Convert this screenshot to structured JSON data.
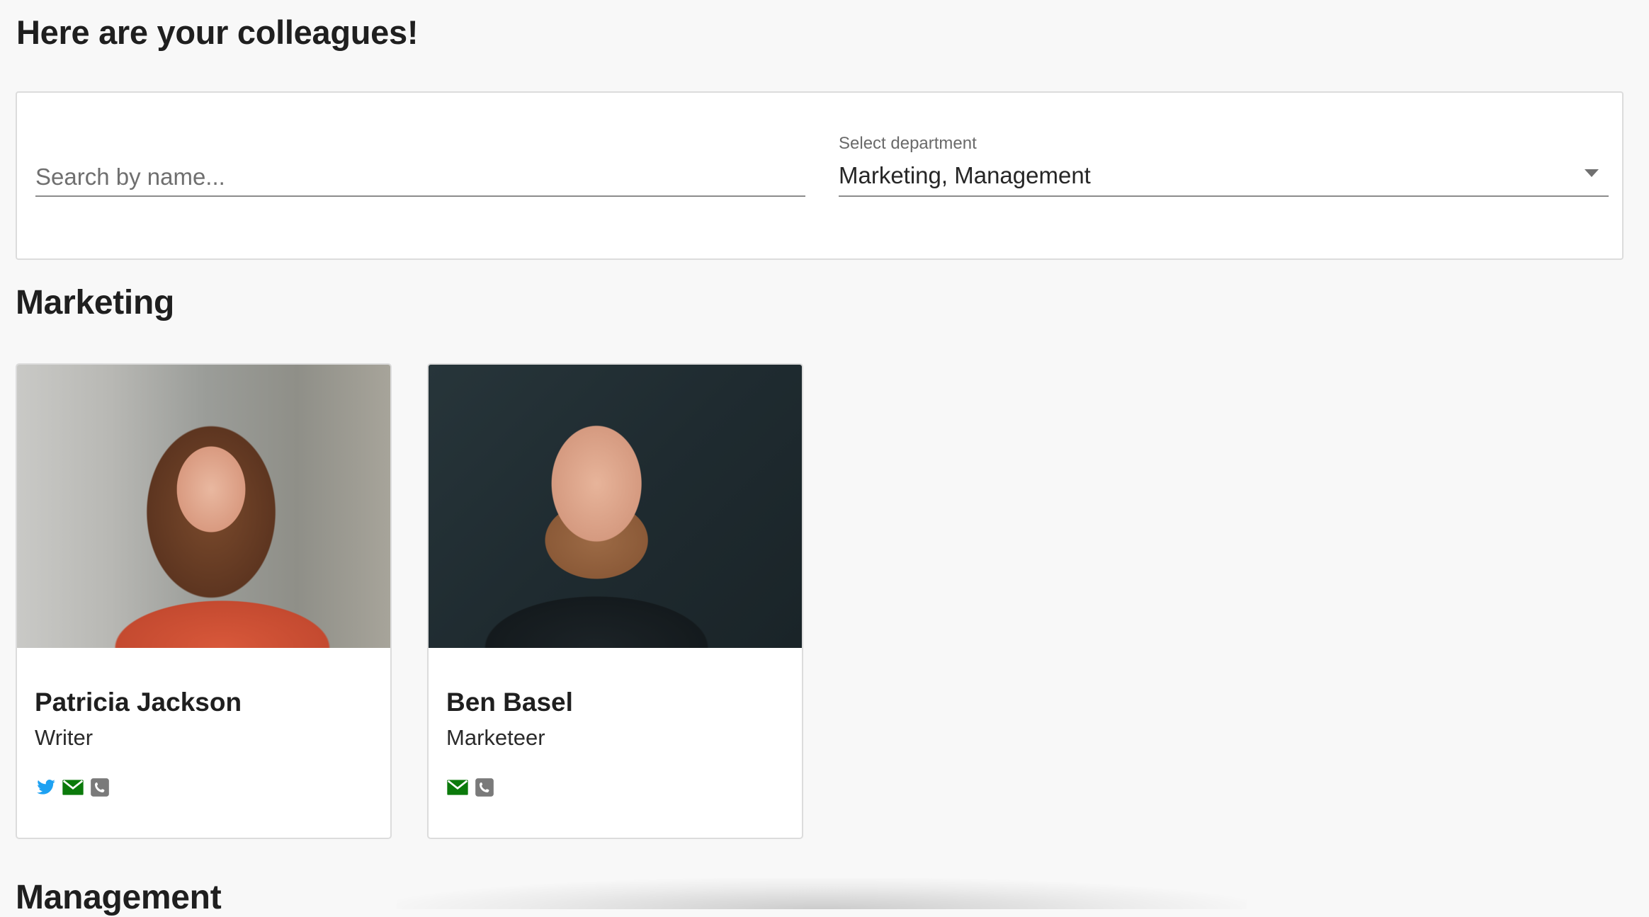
{
  "header": {
    "title": "Here are your colleagues!"
  },
  "filters": {
    "search_placeholder": "Search by name...",
    "search_value": "",
    "department_label": "Select department",
    "department_value": "Marketing, Management"
  },
  "sections": [
    {
      "title": "Marketing",
      "colleagues": [
        {
          "name": "Patricia Jackson",
          "role": "Writer",
          "contacts": [
            "twitter-icon",
            "email-icon",
            "phone-icon"
          ]
        },
        {
          "name": "Ben Basel",
          "role": "Marketeer",
          "contacts": [
            "email-icon",
            "phone-icon"
          ]
        }
      ]
    },
    {
      "title": "Management",
      "colleagues": []
    }
  ],
  "colors": {
    "twitter": "#1da1f2",
    "email": "#0b7a0b",
    "phone": "#7a7a7a"
  }
}
